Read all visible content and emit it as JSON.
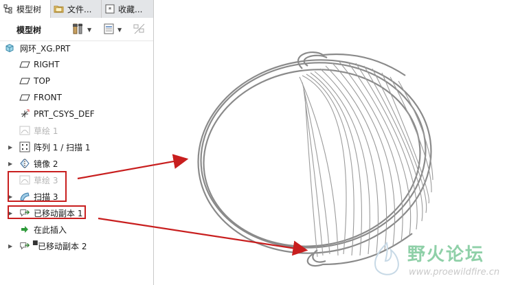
{
  "tabs": [
    {
      "label": "模型树",
      "icon": "model-tree-icon"
    },
    {
      "label": "文件...",
      "icon": "folder-icon"
    },
    {
      "label": "收藏...",
      "icon": "favorites-icon"
    }
  ],
  "toolbar": {
    "title": "模型树",
    "settings_icon": "tree-settings-icon",
    "columns_icon": "tree-columns-icon",
    "filter_icon": "tree-filter-icon"
  },
  "tree": {
    "root": "网环_XG.PRT",
    "items": [
      {
        "label": "RIGHT",
        "icon": "datum-plane-icon",
        "expandable": false,
        "disabled": false
      },
      {
        "label": "TOP",
        "icon": "datum-plane-icon",
        "expandable": false,
        "disabled": false
      },
      {
        "label": "FRONT",
        "icon": "datum-plane-icon",
        "expandable": false,
        "disabled": false
      },
      {
        "label": "PRT_CSYS_DEF",
        "icon": "csys-icon",
        "expandable": false,
        "disabled": false
      },
      {
        "label": "草绘 1",
        "icon": "sketch-icon",
        "expandable": false,
        "disabled": true
      },
      {
        "label": "阵列 1 / 扫描 1",
        "icon": "pattern-icon",
        "expandable": true,
        "disabled": false
      },
      {
        "label": "镜像 2",
        "icon": "mirror-icon",
        "expandable": true,
        "disabled": false
      },
      {
        "label": "草绘 3",
        "icon": "sketch-icon",
        "expandable": false,
        "disabled": true
      },
      {
        "label": "扫描 3",
        "icon": "sweep-icon",
        "expandable": true,
        "disabled": false
      },
      {
        "label": "已移动副本 1",
        "icon": "moved-copy-icon",
        "expandable": true,
        "disabled": false
      },
      {
        "label": "在此插入",
        "icon": "insert-here-icon",
        "expandable": false,
        "disabled": false
      },
      {
        "label": "已移动副本 2",
        "icon": "moved-copy-icon",
        "expandable": true,
        "disabled": false
      }
    ]
  },
  "watermark": {
    "title": "野火论坛",
    "url": "www.proewildfire.cn"
  },
  "colors": {
    "annotation_red": "#c81e1e",
    "model_gray": "#8a8a8a",
    "watermark_green": "#8fd0a8"
  }
}
